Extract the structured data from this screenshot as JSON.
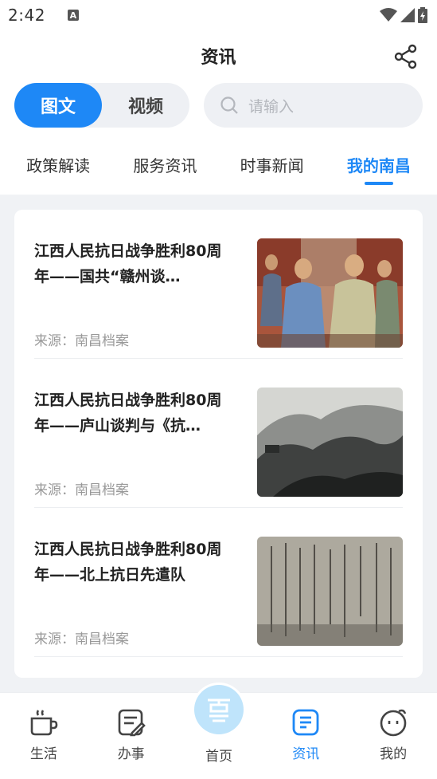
{
  "status_bar": {
    "time": "2:42",
    "badge": "A"
  },
  "header": {
    "title": "资讯"
  },
  "mode": {
    "items": [
      "图文",
      "视频"
    ],
    "active": "图文"
  },
  "search": {
    "placeholder": "请输入"
  },
  "tabs": [
    {
      "label": "政策解读"
    },
    {
      "label": "服务资讯"
    },
    {
      "label": "时事新闻"
    },
    {
      "label": "我的南昌"
    }
  ],
  "active_tab": "我的南昌",
  "articles": [
    {
      "title": "江西人民抗日战争胜利80周年——国共“赣州谈…",
      "source": "来源：南昌档案"
    },
    {
      "title": "江西人民抗日战争胜利80周年——庐山谈判与《抗…",
      "source": "来源：南昌档案"
    },
    {
      "title": "江西人民抗日战争胜利80周年——北上抗日先遣队",
      "source": "来源：南昌档案"
    }
  ],
  "bottom_nav": [
    {
      "label": "生活",
      "icon": "coffee-cup-icon"
    },
    {
      "label": "办事",
      "icon": "document-edit-icon"
    },
    {
      "label": "首页",
      "icon": "home-logo-icon"
    },
    {
      "label": "资讯",
      "icon": "news-list-icon"
    },
    {
      "label": "我的",
      "icon": "profile-face-icon"
    }
  ],
  "colors": {
    "accent": "#1e88f6",
    "background": "#f0f2f5"
  }
}
